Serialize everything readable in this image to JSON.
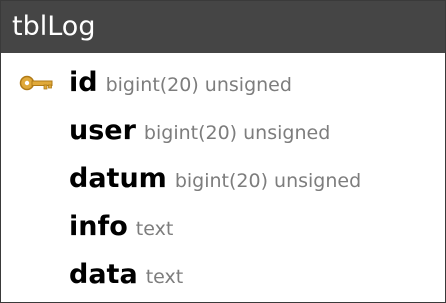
{
  "table": {
    "name": "tblLog",
    "fields": [
      {
        "name": "id",
        "type": "bigint(20) unsigned",
        "primary_key": true,
        "icon": "key-icon"
      },
      {
        "name": "user",
        "type": "bigint(20) unsigned",
        "primary_key": false
      },
      {
        "name": "datum",
        "type": "bigint(20) unsigned",
        "primary_key": false
      },
      {
        "name": "info",
        "type": "text",
        "primary_key": false
      },
      {
        "name": "data",
        "type": "text",
        "primary_key": false
      }
    ]
  },
  "colors": {
    "header_bg": "#454545",
    "header_text": "#ffffff",
    "field_name": "#000000",
    "field_type": "#7d7d7d",
    "key_icon": "#e0a93a"
  }
}
